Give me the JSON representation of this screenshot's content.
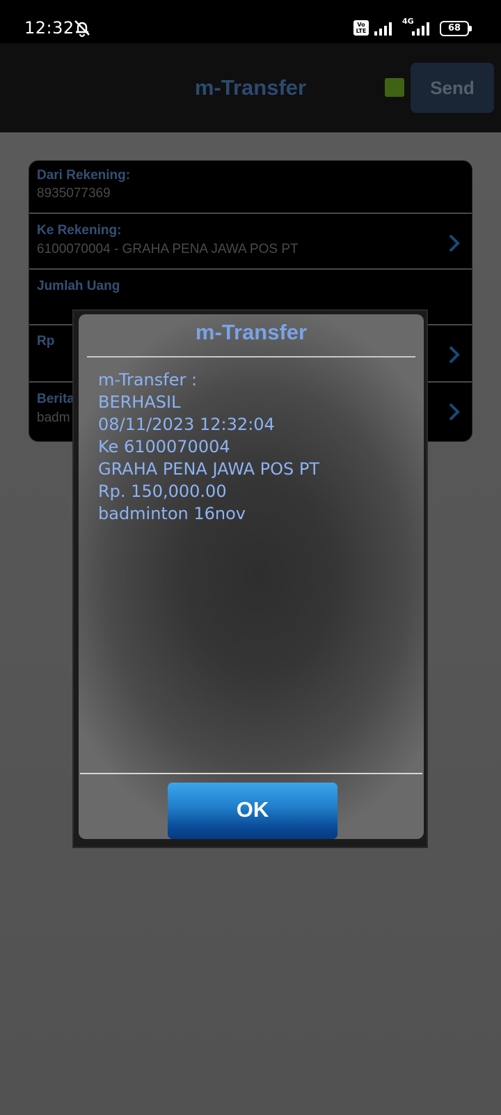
{
  "status_bar": {
    "time": "12:32",
    "volte": "Vo LTE",
    "network": "4G",
    "battery": "68",
    "icons": [
      "mute-icon",
      "signal-icon",
      "battery-icon"
    ]
  },
  "app_bar": {
    "title": "m-Transfer",
    "send_label": "Send",
    "status_color": "#3f6214"
  },
  "form": {
    "rows": [
      {
        "label": "Dari Rekening:",
        "value": "8935077369"
      },
      {
        "label": "Ke Rekening:",
        "value": "6100070004 - GRAHA PENA JAWA POS PT"
      },
      {
        "label": "Jumlah Uang",
        "value": ""
      },
      {
        "label": "Rp",
        "value": ""
      },
      {
        "label": "Berita",
        "value": "badm"
      }
    ]
  },
  "dialog": {
    "title": "m-Transfer",
    "lines": [
      "m-Transfer :",
      "BERHASIL",
      "08/11/2023 12:32:04",
      "Ke 6100070004",
      "GRAHA PENA JAWA POS PT",
      "Rp. 150,000.00",
      "badminton 16nov"
    ],
    "ok_label": "OK"
  },
  "colors": {
    "accent": "#7aa3e8",
    "ok_button": "#1f7cc8"
  }
}
